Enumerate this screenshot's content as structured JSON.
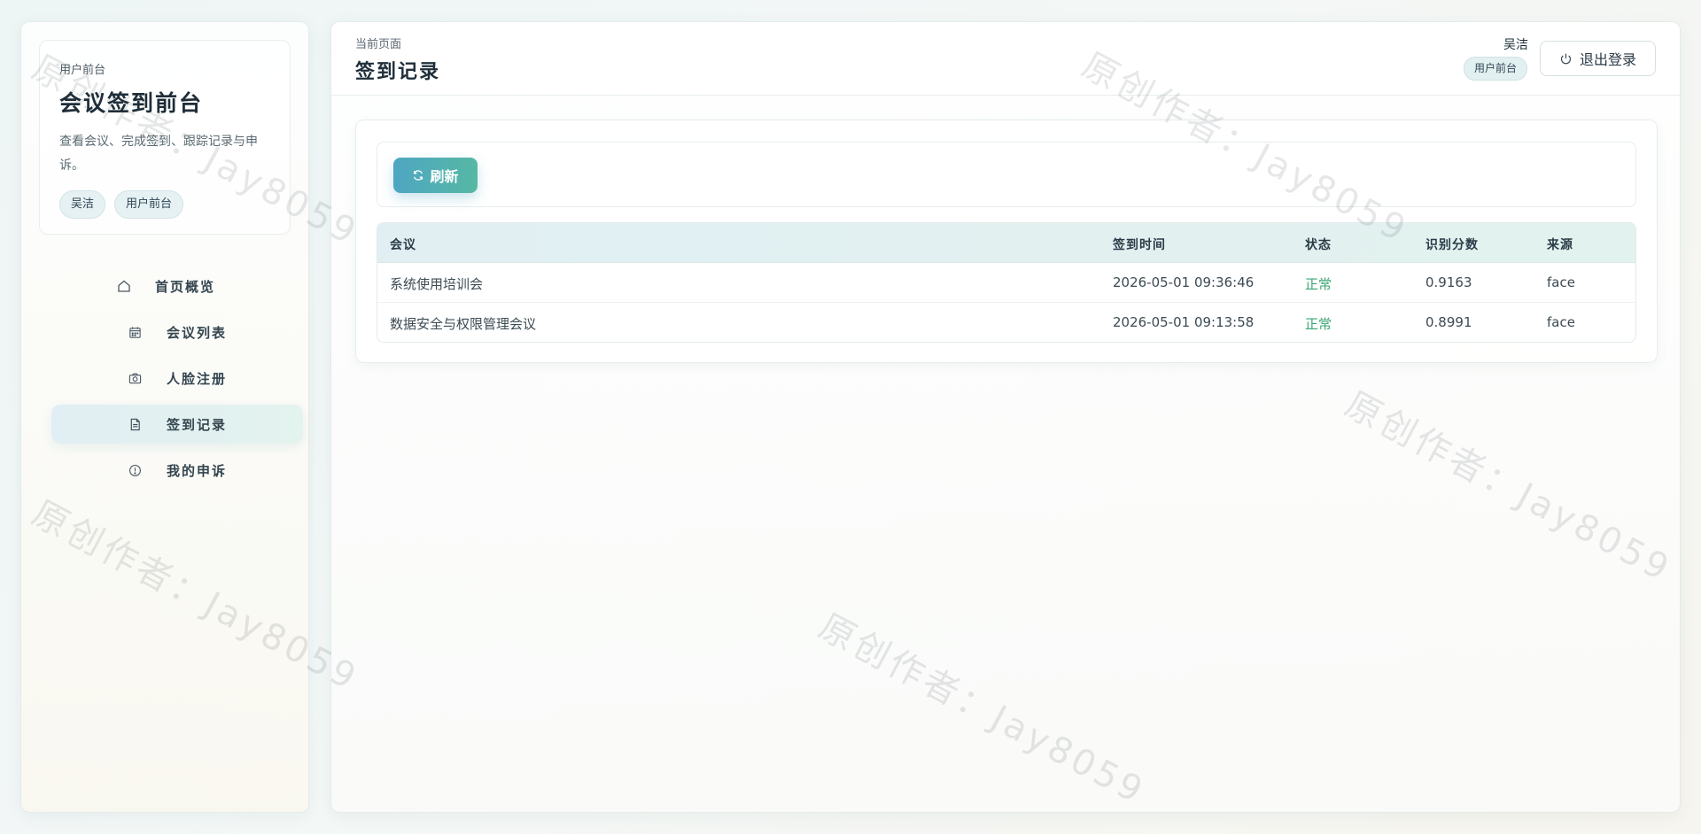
{
  "sidebar": {
    "eyebrow": "用户前台",
    "title": "会议签到前台",
    "description": "查看会议、完成签到、跟踪记录与申诉。",
    "chips": [
      "吴洁",
      "用户前台"
    ],
    "nav": [
      {
        "label": "首页概览",
        "icon": "home-icon",
        "active": false
      },
      {
        "label": "会议列表",
        "icon": "calendar-icon",
        "active": false
      },
      {
        "label": "人脸注册",
        "icon": "camera-icon",
        "active": false
      },
      {
        "label": "签到记录",
        "icon": "document-icon",
        "active": true
      },
      {
        "label": "我的申诉",
        "icon": "alert-circle-icon",
        "active": false
      }
    ]
  },
  "header": {
    "breadcrumb": "当前页面",
    "title": "签到记录",
    "user_name": "吴洁",
    "role": "用户前台",
    "logout_label": "退出登录"
  },
  "toolbar": {
    "refresh_label": "刷新"
  },
  "table": {
    "columns": [
      "会议",
      "签到时间",
      "状态",
      "识别分数",
      "来源"
    ],
    "rows": [
      [
        "系统使用培训会",
        "2026-05-01 09:36:46",
        "正常",
        "0.9163",
        "face"
      ],
      [
        "数据安全与权限管理会议",
        "2026-05-01 09:13:58",
        "正常",
        "0.8991",
        "face"
      ]
    ]
  },
  "watermark": "原创作者：Jay8059",
  "colors": {
    "accent_start": "#4ea6c2",
    "accent_end": "#56b8a4",
    "status_ok": "#3aa672"
  }
}
